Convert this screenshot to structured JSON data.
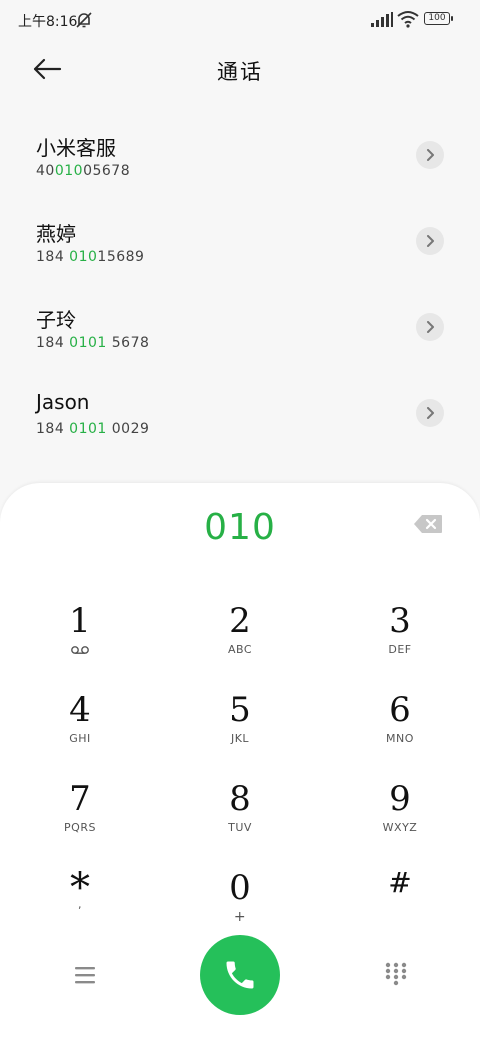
{
  "status_bar": {
    "time": "上午8:16",
    "battery": "100"
  },
  "header": {
    "title": "通话"
  },
  "contacts": [
    {
      "name": "小米客服",
      "number_pre": "40",
      "number_hl": "010",
      "number_post": "05678"
    },
    {
      "name": "燕婷",
      "number_pre": "184 ",
      "number_hl": "010",
      "number_post": "15689"
    },
    {
      "name": "子玲",
      "number_pre": "184 ",
      "number_hl": "0101",
      "number_post": " 5678"
    },
    {
      "name": "Jason",
      "number_pre": "184 ",
      "number_hl": "0101",
      "number_post": " 0029"
    }
  ],
  "dial": {
    "entered": "010"
  },
  "keypad": [
    {
      "digit": "1",
      "letters": ""
    },
    {
      "digit": "2",
      "letters": "ABC"
    },
    {
      "digit": "3",
      "letters": "DEF"
    },
    {
      "digit": "4",
      "letters": "GHI"
    },
    {
      "digit": "5",
      "letters": "JKL"
    },
    {
      "digit": "6",
      "letters": "MNO"
    },
    {
      "digit": "7",
      "letters": "PQRS"
    },
    {
      "digit": "8",
      "letters": "TUV"
    },
    {
      "digit": "9",
      "letters": "WXYZ"
    },
    {
      "digit": "*",
      "letters": ","
    },
    {
      "digit": "0",
      "letters": "+"
    },
    {
      "digit": "#",
      "letters": ""
    }
  ],
  "colors": {
    "accent": "#27b046",
    "call_button": "#25c05a"
  },
  "icons": {
    "back": "arrow-left",
    "detail": "chevron-right",
    "backspace": "backspace",
    "voicemail": "voicemail",
    "menu": "hamburger",
    "call": "phone",
    "dialpad": "dialpad-grid"
  }
}
